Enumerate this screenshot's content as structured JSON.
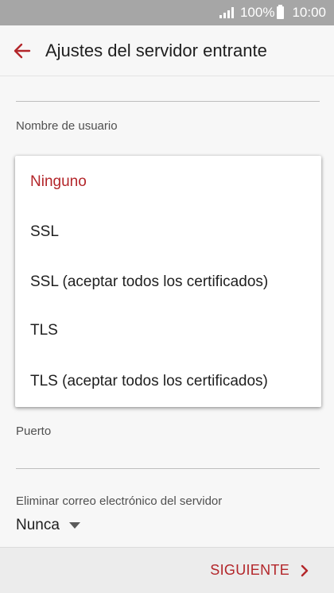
{
  "status_bar": {
    "battery": "100%",
    "time": "10:00"
  },
  "header": {
    "title": "Ajustes del servidor entrante"
  },
  "form": {
    "username_label": "Nombre de usuario",
    "port_label": "Puerto",
    "delete_label": "Eliminar correo electrónico del servidor",
    "delete_value": "Nunca"
  },
  "security_menu": {
    "options": [
      {
        "label": "Ninguno",
        "selected": true
      },
      {
        "label": "SSL",
        "selected": false
      },
      {
        "label": "SSL (aceptar todos los certificados)",
        "selected": false
      },
      {
        "label": "TLS",
        "selected": false
      },
      {
        "label": "TLS (aceptar todos los certificados)",
        "selected": false
      }
    ]
  },
  "footer": {
    "next_label": "SIGUIENTE"
  },
  "colors": {
    "accent": "#b3262a",
    "status_bar": "#a6a6a6"
  }
}
